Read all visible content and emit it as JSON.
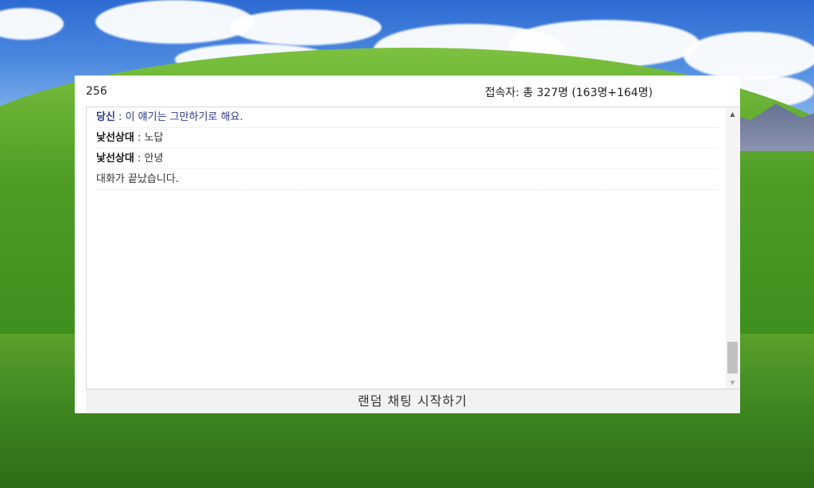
{
  "header": {
    "room_number": "256",
    "stats": "접속자: 총 327명 (163명+164명)"
  },
  "messages": [
    {
      "sender": "당신",
      "separator": " : ",
      "text": "이 얘기는 그만하기로 해요.",
      "type": "me"
    },
    {
      "sender": "낯선상대",
      "separator": " : ",
      "text": "노답",
      "type": "stranger"
    },
    {
      "sender": "낯선상대",
      "separator": " : ",
      "text": "안녕",
      "type": "stranger"
    },
    {
      "sender": "",
      "separator": "",
      "text": "대화가 끝났습니다.",
      "type": "system"
    }
  ],
  "scrollbar": {
    "up_icon": "triangle-up-icon",
    "down_icon": "triangle-down-icon"
  },
  "start_button": {
    "label": "랜덤 채팅 시작하기"
  },
  "colors": {
    "me_text": "#2b3a8c",
    "stranger_name": "#1a1a1a",
    "window_bg": "#ffffff",
    "button_bg": "#f2f2f2"
  }
}
